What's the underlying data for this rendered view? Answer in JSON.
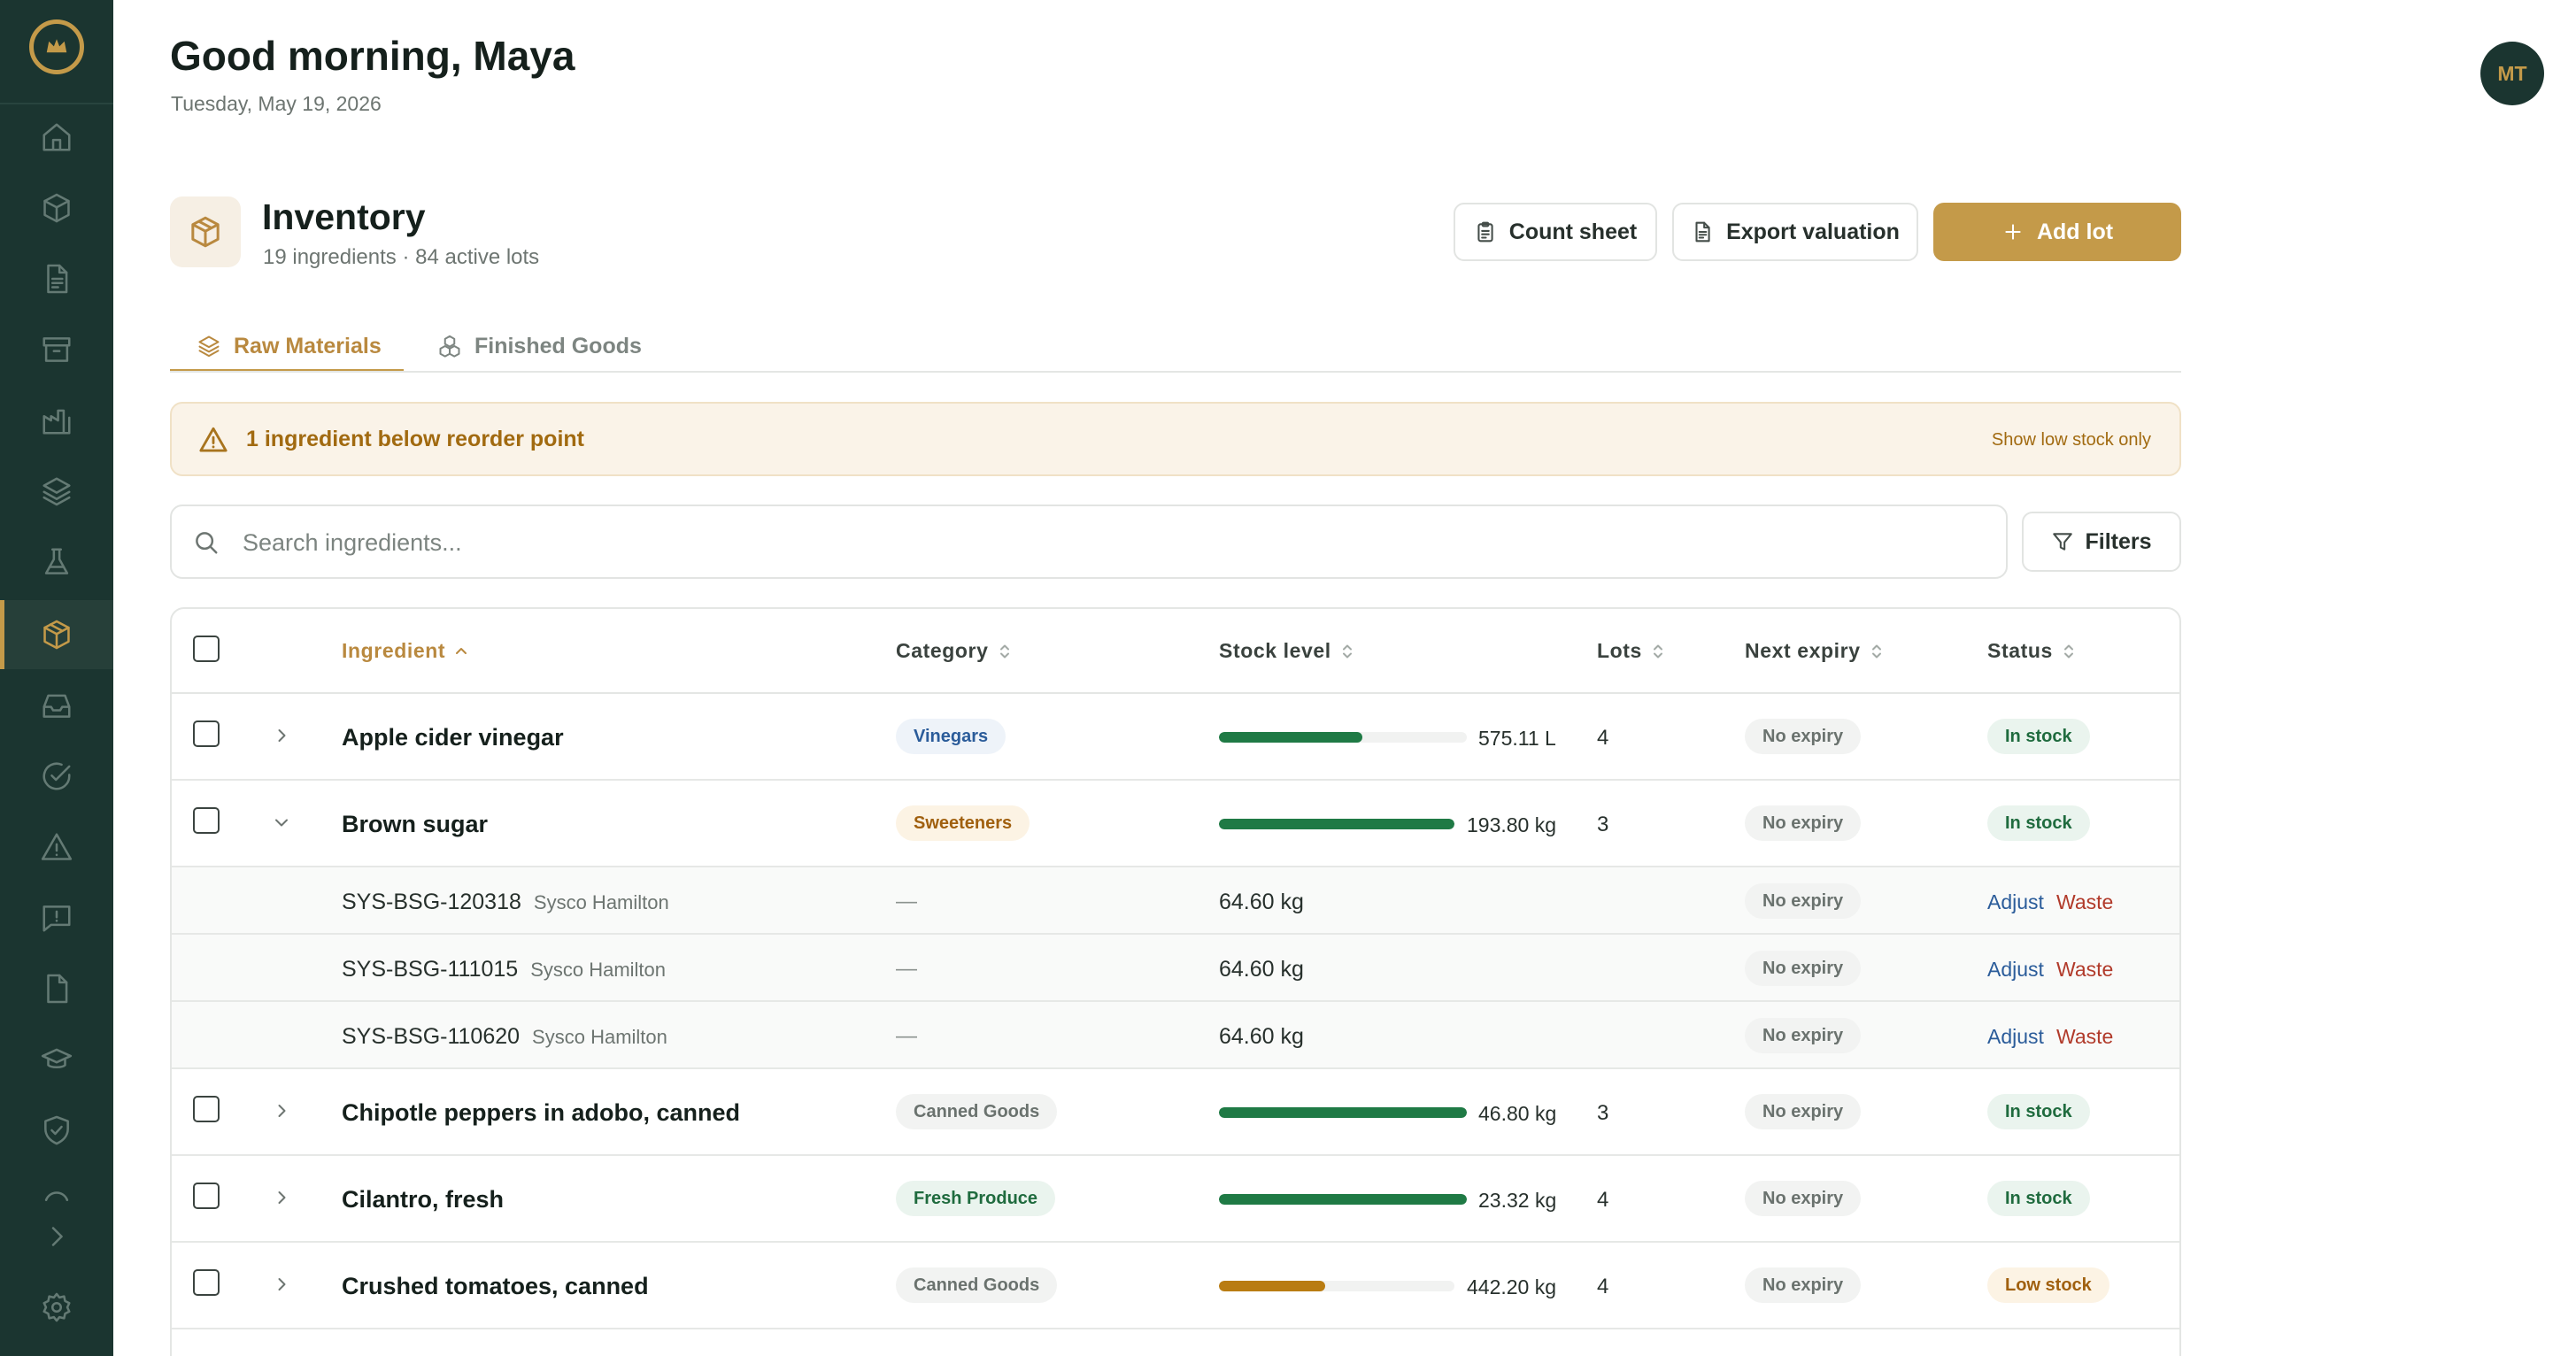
{
  "header": {
    "greeting": "Good morning, Maya",
    "date": "Tuesday, May 19, 2026",
    "avatar_initials": "MT"
  },
  "sidebar": {
    "items": [
      {
        "icon": "home-icon",
        "active": false
      },
      {
        "icon": "box-icon",
        "active": false
      },
      {
        "icon": "document-icon",
        "active": false
      },
      {
        "icon": "archive-icon",
        "active": false
      },
      {
        "icon": "factory-icon",
        "active": false
      },
      {
        "icon": "layers-icon",
        "active": false
      },
      {
        "icon": "flask-icon",
        "active": false
      },
      {
        "icon": "package-icon",
        "active": true
      },
      {
        "icon": "inbox-icon",
        "active": false
      },
      {
        "icon": "check-circle-icon",
        "active": false
      },
      {
        "icon": "warning-icon",
        "active": false
      },
      {
        "icon": "message-alert-icon",
        "active": false
      },
      {
        "icon": "file-icon",
        "active": false
      },
      {
        "icon": "graduation-cap-icon",
        "active": false
      },
      {
        "icon": "shield-check-icon",
        "active": false
      },
      {
        "icon": "refresh-icon",
        "active": false
      },
      {
        "icon": "chevron-right-icon",
        "active": false
      },
      {
        "icon": "gear-icon",
        "active": false
      }
    ]
  },
  "inventory": {
    "title": "Inventory",
    "subtitle": "19 ingredients · 84 active lots",
    "count_sheet_label": "Count sheet",
    "export_label": "Export valuation",
    "add_lot_label": "Add lot"
  },
  "tabs": [
    {
      "label": "Raw Materials",
      "active": true
    },
    {
      "label": "Finished Goods",
      "active": false
    }
  ],
  "alert": {
    "text": "1 ingredient below reorder point",
    "action": "Show low stock only"
  },
  "search": {
    "placeholder": "Search ingredients...",
    "value": "",
    "filters_label": "Filters"
  },
  "table": {
    "columns": [
      "Ingredient",
      "Category",
      "Stock level",
      "Lots",
      "Next expiry",
      "Status"
    ],
    "rows": [
      {
        "name": "Apple cider vinegar",
        "category": "Vinegars",
        "stock": "575.11 L",
        "stock_fraction": 0.58,
        "lots": "4",
        "expiry": "No expiry",
        "status": "In stock",
        "expanded": false
      },
      {
        "name": "Brown sugar",
        "category": "Sweeteners",
        "stock": "193.80 kg",
        "stock_fraction": 1.0,
        "lots": "3",
        "expiry": "No expiry",
        "status": "In stock",
        "expanded": true,
        "lots_detail": [
          {
            "id": "SYS-BSG-120318",
            "supplier": "Sysco Hamilton",
            "category": "—",
            "qty": "64.60 kg",
            "expiry": "No expiry",
            "adjust": "Adjust",
            "waste": "Waste"
          },
          {
            "id": "SYS-BSG-111015",
            "supplier": "Sysco Hamilton",
            "category": "—",
            "qty": "64.60 kg",
            "expiry": "No expiry",
            "adjust": "Adjust",
            "waste": "Waste"
          },
          {
            "id": "SYS-BSG-110620",
            "supplier": "Sysco Hamilton",
            "category": "—",
            "qty": "64.60 kg",
            "expiry": "No expiry",
            "adjust": "Adjust",
            "waste": "Waste"
          }
        ]
      },
      {
        "name": "Chipotle peppers in adobo, canned",
        "category": "Canned Goods",
        "stock": "46.80 kg",
        "stock_fraction": 1.0,
        "lots": "3",
        "expiry": "No expiry",
        "status": "In stock",
        "expanded": false
      },
      {
        "name": "Cilantro, fresh",
        "category": "Fresh Produce",
        "stock": "23.32 kg",
        "stock_fraction": 1.0,
        "lots": "4",
        "expiry": "No expiry",
        "status": "In stock",
        "expanded": false
      },
      {
        "name": "Crushed tomatoes, canned",
        "category": "Canned Goods",
        "stock": "442.20 kg",
        "stock_fraction": 0.45,
        "lots": "4",
        "expiry": "No expiry",
        "status": "Low stock",
        "expanded": false
      }
    ]
  },
  "colors": {
    "sidebar_bg": "#1b3530",
    "accent_gold": "#c49a49",
    "stock_ok": "#1f7a45",
    "stock_low": "#b97c12"
  }
}
